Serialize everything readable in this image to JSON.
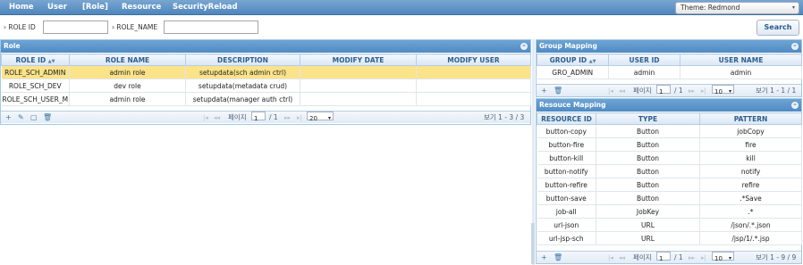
{
  "menu": {
    "items": [
      "Home",
      "User",
      "[Role]",
      "Resource",
      "SecurityReload"
    ]
  },
  "theme": {
    "label": "Theme: Redmond"
  },
  "search": {
    "role_id_label": "ROLE ID",
    "role_name_label": "ROLE_NAME",
    "button": "Search"
  },
  "role_panel": {
    "title": "Role",
    "columns": [
      "ROLE ID",
      "ROLE NAME",
      "DESCRIPTION",
      "MODIFY DATE",
      "MODIFY USER"
    ],
    "rows": [
      [
        "ROLE_SCH_ADMIN",
        "admin role",
        "setupdata(sch admin ctrl)",
        "",
        ""
      ],
      [
        "ROLE_SCH_DEV",
        "dev role",
        "setupdata(metadata crud)",
        "",
        ""
      ],
      [
        "ROLE_SCH_USER_M",
        "admin role",
        "setupdata(manager auth ctrl)",
        "",
        ""
      ]
    ],
    "pager": {
      "page_label": "페이지",
      "page": "1",
      "of": "/ 1",
      "rows": "20",
      "info": "보기 1 - 3 / 3"
    }
  },
  "group_panel": {
    "title": "Group Mapping",
    "columns": [
      "GROUP ID",
      "USER ID",
      "USER NAME"
    ],
    "rows": [
      [
        "GRO_ADMIN",
        "admin",
        "admin"
      ]
    ],
    "pager": {
      "page_label": "페이지",
      "page": "1",
      "of": "/ 1",
      "rows": "10",
      "info": "보기 1 - 1 / 1"
    }
  },
  "resource_panel": {
    "title": "Resouce Mapping",
    "columns": [
      "RESOURCE ID",
      "TYPE",
      "PATTERN"
    ],
    "rows": [
      [
        "button-copy",
        "Button",
        "jobCopy"
      ],
      [
        "button-fire",
        "Button",
        "fire"
      ],
      [
        "button-kill",
        "Button",
        "kill"
      ],
      [
        "button-notify",
        "Button",
        "notify"
      ],
      [
        "button-refire",
        "Button",
        "refire"
      ],
      [
        "button-save",
        "Button",
        ".*Save"
      ],
      [
        "job-all",
        "JobKey",
        ".*"
      ],
      [
        "url-json",
        "URL",
        "/json/.*.json"
      ],
      [
        "url-jsp-sch",
        "URL",
        "/jsp/1/.*.jsp"
      ]
    ],
    "pager": {
      "page_label": "페이지",
      "page": "1",
      "of": "/ 1",
      "rows": "10",
      "info": "보기 1 - 9 / 9"
    }
  },
  "colors": {
    "header": "#4f8bc4",
    "selected_row": "#fbe38a"
  }
}
